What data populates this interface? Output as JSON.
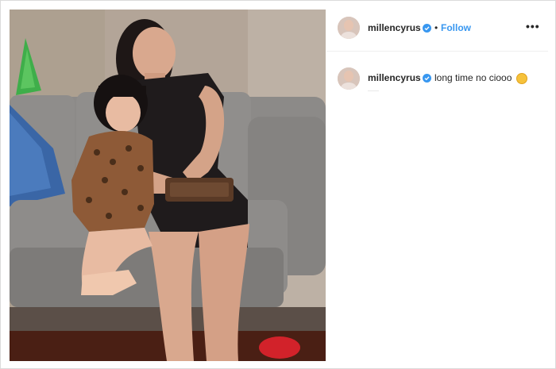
{
  "post": {
    "image": {
      "alt": "",
      "colors": {
        "wall": "#b0a294",
        "sofa": "#8a8886",
        "cushion": "#3d6aa8",
        "dress": "#1f1b1c",
        "floor": "#6a2a1c"
      }
    }
  },
  "header": {
    "username": "millencyrus",
    "verified_icon": "verified-badge-icon",
    "separator": "•",
    "follow_label": "Follow",
    "more_icon": "more-options-icon",
    "more_glyph": "•••"
  },
  "comment": {
    "username": "millencyrus",
    "text": "long time no ciooo",
    "emoji_icon": "kissing-face-emoji-icon"
  },
  "accent_color": "#3897f0"
}
